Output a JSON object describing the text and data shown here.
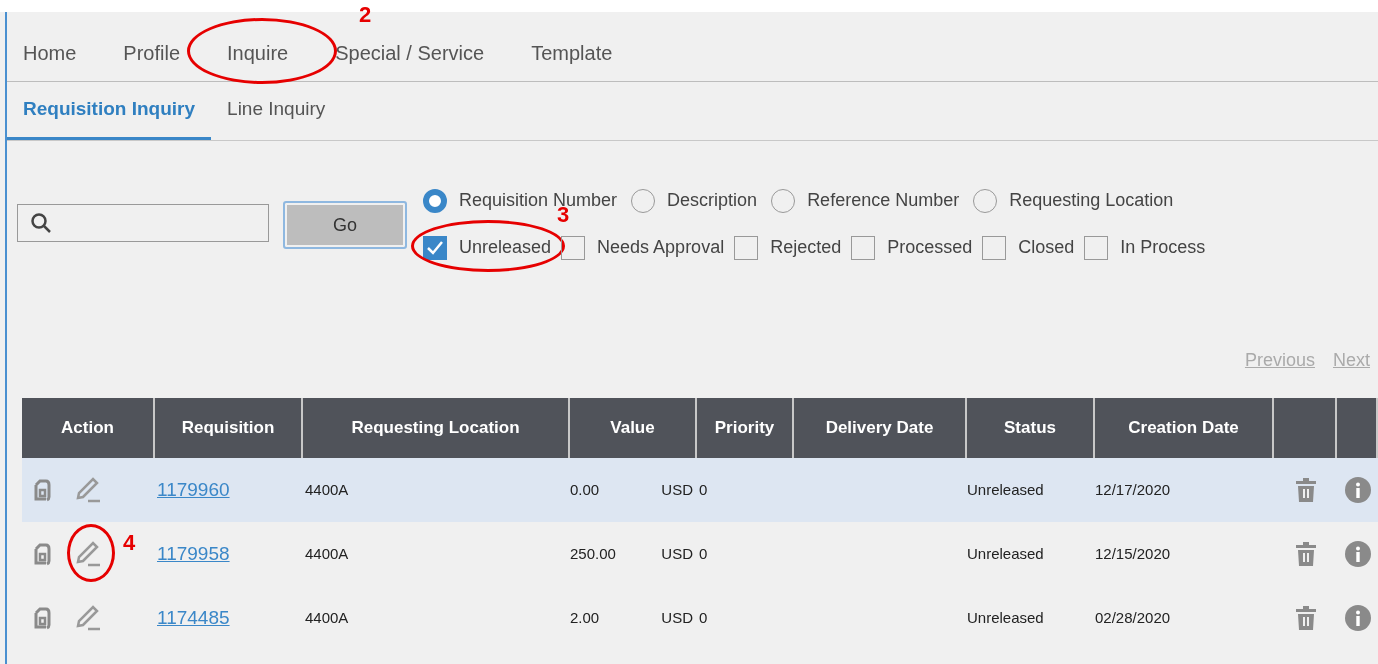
{
  "nav": [
    {
      "label": "Home",
      "selected": false
    },
    {
      "label": "Profile",
      "selected": false
    },
    {
      "label": "Inquire",
      "selected": false,
      "annotation": "2"
    },
    {
      "label": "Special / Service",
      "selected": false
    },
    {
      "label": "Template",
      "selected": false
    }
  ],
  "subtabs": [
    {
      "label": "Requisition Inquiry",
      "selected": true
    },
    {
      "label": "Line Inquiry",
      "selected": false
    }
  ],
  "search": {
    "button": "Go"
  },
  "search_by": [
    {
      "label": "Requisition Number",
      "selected": true
    },
    {
      "label": "Description",
      "selected": false
    },
    {
      "label": "Reference Number",
      "selected": false
    },
    {
      "label": "Requesting Location",
      "selected": false
    }
  ],
  "status_filters": [
    {
      "label": "Unreleased",
      "checked": true,
      "annotation": "3"
    },
    {
      "label": "Needs Approval",
      "checked": false
    },
    {
      "label": "Rejected",
      "checked": false
    },
    {
      "label": "Processed",
      "checked": false
    },
    {
      "label": "Closed",
      "checked": false
    },
    {
      "label": "In Process",
      "checked": false
    }
  ],
  "pager": [
    "Previous",
    "Next"
  ],
  "table": {
    "columns": [
      "Action",
      "Requisition",
      "Requesting Location",
      "Value",
      "Priority",
      "Delivery Date",
      "Status",
      "Creation Date"
    ],
    "rows": [
      {
        "requisition": "1179960",
        "location": "4400A",
        "value": "0.00",
        "currency": "USD",
        "priority": "0",
        "status": "Unreleased",
        "created": "12/17/2020",
        "highlighted": true
      },
      {
        "requisition": "1179958",
        "location": "4400A",
        "value": "250.00",
        "currency": "USD",
        "priority": "0",
        "status": "Unreleased",
        "created": "12/15/2020",
        "highlighted": false,
        "annotation": "4"
      },
      {
        "requisition": "1174485",
        "location": "4400A",
        "value": "2.00",
        "currency": "USD",
        "priority": "0",
        "status": "Unreleased",
        "created": "02/28/2020",
        "highlighted": false
      }
    ]
  }
}
